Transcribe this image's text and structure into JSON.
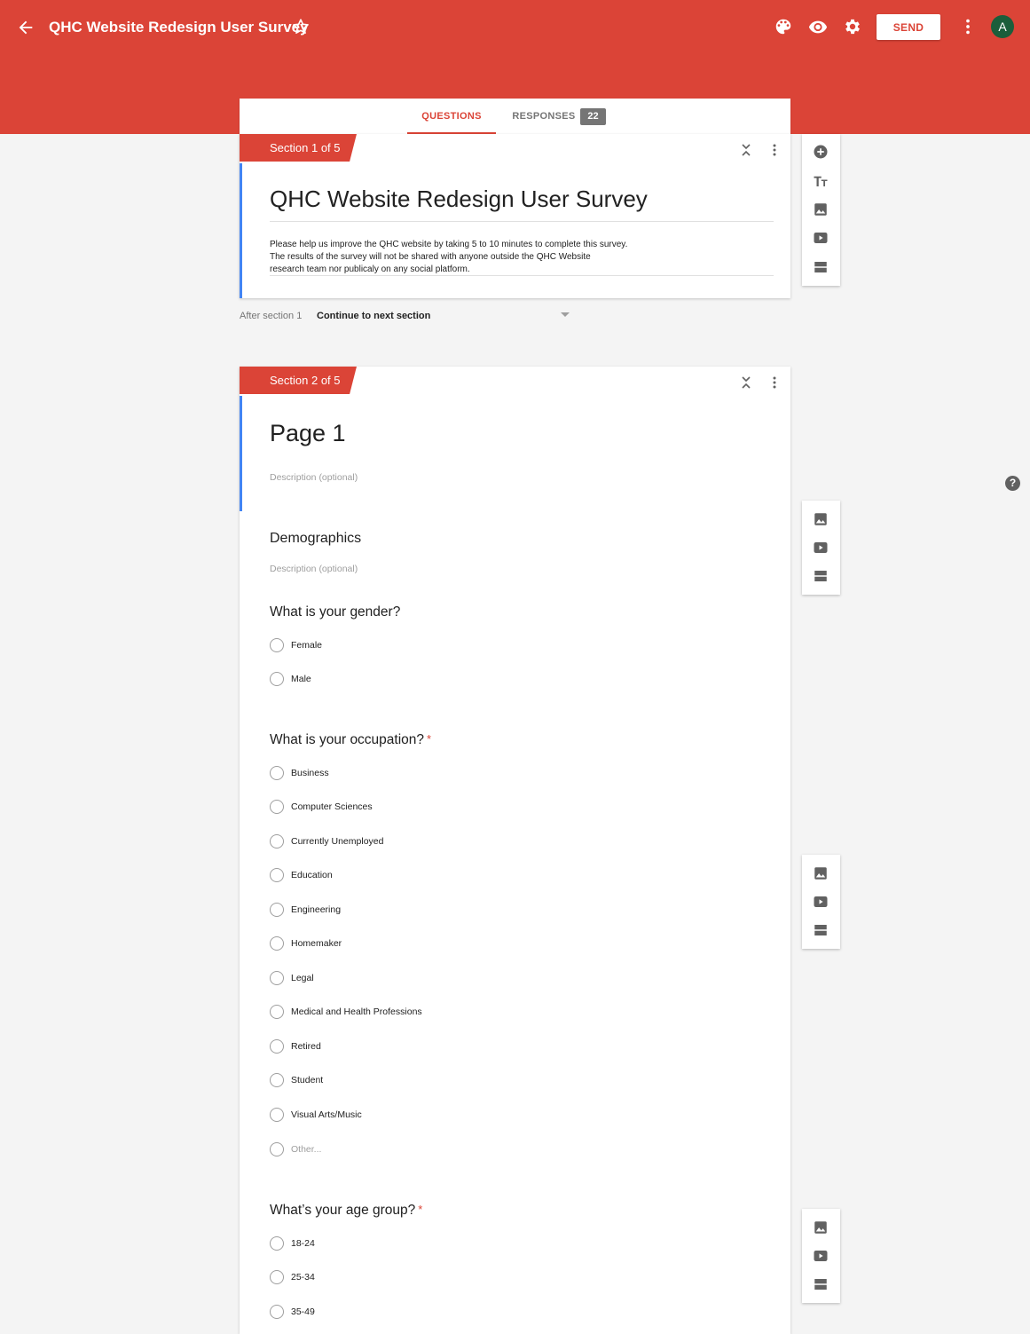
{
  "topbar": {
    "title": "QHC Website Redesign User Survey",
    "send_label": "SEND",
    "avatar_letter": "A"
  },
  "tabs": {
    "questions": "QUESTIONS",
    "responses": "RESPONSES",
    "responses_count": "22"
  },
  "section1": {
    "tag": "Section 1 of 5",
    "title": "QHC Website Redesign User Survey",
    "description_lines": [
      "Please help us improve the QHC website by taking 5 to 10 minutes to complete this survey.",
      "The results of the survey will not be shared with anyone outside the QHC Website",
      "research team nor publicaly on any social platform."
    ]
  },
  "after_section": {
    "label": "After section 1",
    "value": "Continue to next section"
  },
  "section2": {
    "tag": "Section 2 of 5",
    "title": "Page 1",
    "description_placeholder": "Description (optional)",
    "block": {
      "title": "Demographics",
      "description_placeholder": "Description (optional)"
    },
    "questions": [
      {
        "title": "What is your gender?",
        "required": false,
        "options": [
          "Female",
          "Male"
        ]
      },
      {
        "title": "What is your occupation?",
        "required": true,
        "options": [
          "Business",
          "Computer Sciences",
          "Currently Unemployed",
          "Education",
          "Engineering",
          "Homemaker",
          "Legal",
          "Medical and Health Professions",
          "Retired",
          "Student",
          "Visual Arts/Music"
        ],
        "other": "Other..."
      },
      {
        "title": "What’s your age group?",
        "required": true,
        "options": [
          "18-24",
          "25-34",
          "35-49"
        ]
      }
    ]
  },
  "required_marker": "*",
  "help_label": "?",
  "colors": {
    "brand": "#db4437",
    "accent_bar": "#4285f4",
    "background": "#f4f4f4"
  },
  "icons": {
    "topbar": [
      "back-arrow-icon",
      "star-icon",
      "palette-icon",
      "eye-icon",
      "gear-icon",
      "more-vert-icon"
    ],
    "side_toolbar": [
      "add-circle-icon",
      "title-text-icon",
      "image-icon",
      "video-icon",
      "section-icon"
    ]
  }
}
